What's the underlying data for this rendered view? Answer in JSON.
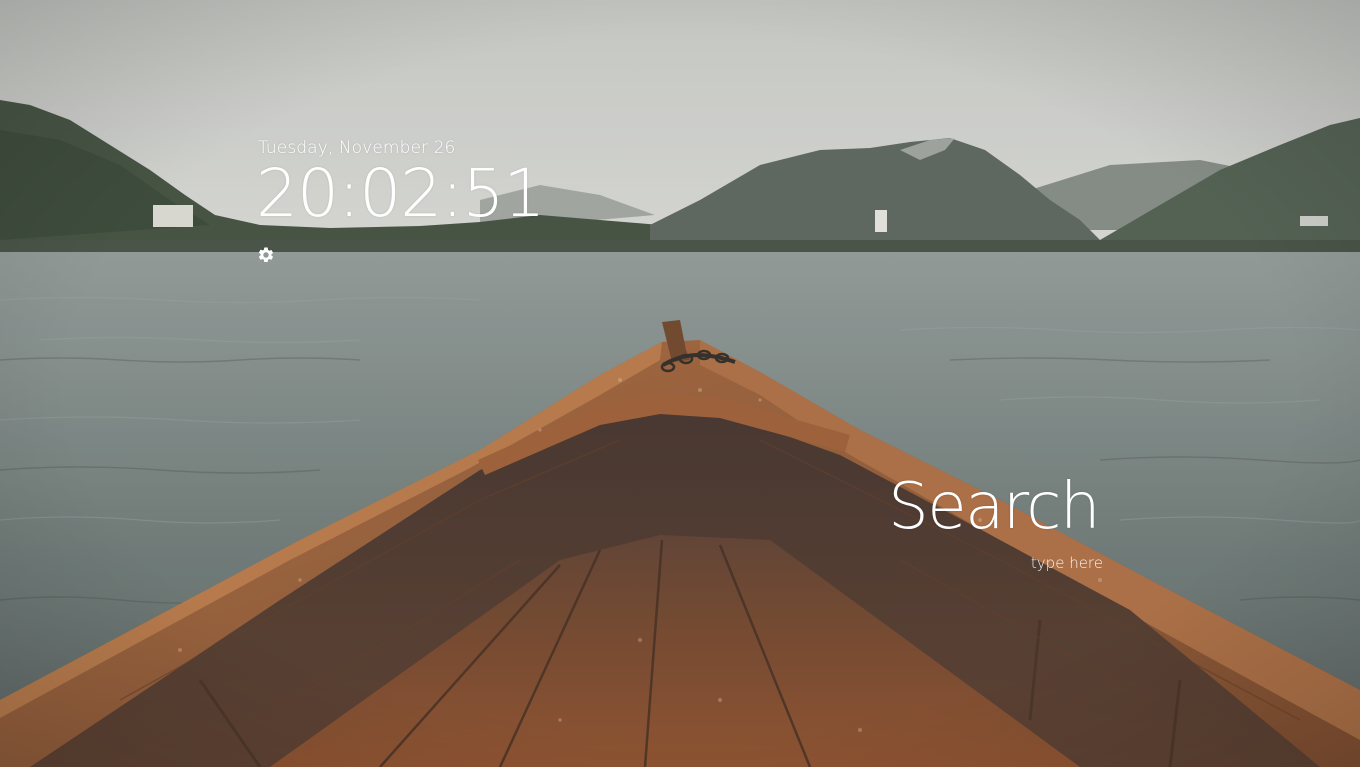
{
  "clock_widget": {
    "date": "Tuesday, November 26",
    "time": "20:02:51",
    "settings_icon": "gear-icon"
  },
  "search_widget": {
    "title": "Search",
    "placeholder": "type here",
    "value": ""
  },
  "background": {
    "description_icon": "lake-boat-wallpaper",
    "sky_color": "#c9cac7",
    "water_color": "#6b7676",
    "boat_color": "#8a4f2c"
  }
}
